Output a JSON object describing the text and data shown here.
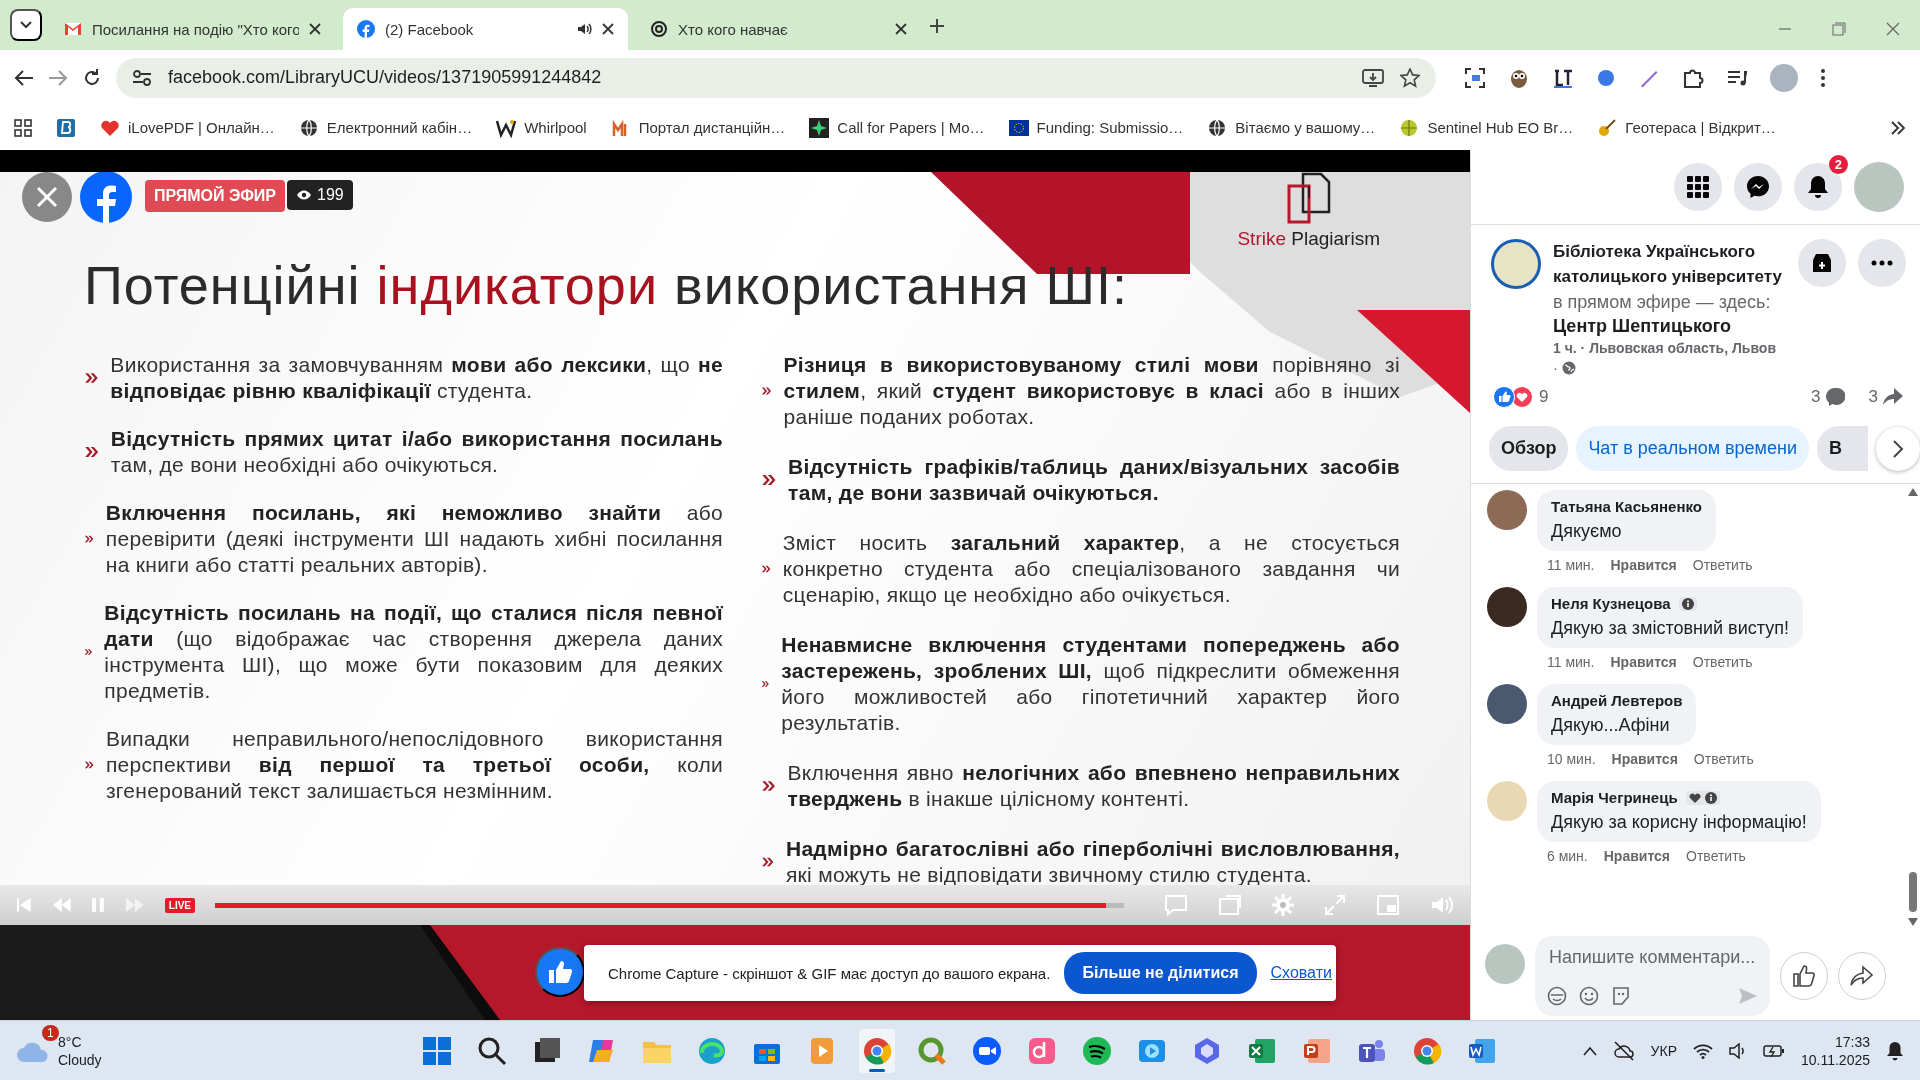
{
  "browser": {
    "tabs": [
      {
        "title": "Посилання на подію \"Хто кого",
        "audio": false,
        "selected": false
      },
      {
        "title": "(2) Facebook",
        "audio": true,
        "selected": true
      },
      {
        "title": "Хто кого навчає",
        "audio": false,
        "selected": false
      }
    ],
    "url": "facebook.com/LibraryUCU/videos/1371905991244842",
    "bookmarks": [
      {
        "label": "iLovePDF | Онлайн…"
      },
      {
        "label": "Електронний кабін…"
      },
      {
        "label": "Whirlpool"
      },
      {
        "label": "Портал дистанційн…"
      },
      {
        "label": "Call for Papers | Mo…"
      },
      {
        "label": "Funding: Submissio…"
      },
      {
        "label": "Вітаємо у вашому…"
      },
      {
        "label": "Sentinel Hub EO Br…"
      },
      {
        "label": "Геотераса | Відкрит…"
      }
    ]
  },
  "video": {
    "overlay": {
      "live_badge": "ПРЯМОЙ ЭФИР",
      "viewers": "199"
    },
    "slide": {
      "logo": [
        {
          "text": "Strike",
          "accent": true
        },
        {
          "text": " Plagiarism",
          "accent": false
        }
      ],
      "title": [
        {
          "text": "Потенційні ",
          "accent": false
        },
        {
          "text": "індикатори",
          "accent": true
        },
        {
          "text": " використання ШІ:",
          "accent": false
        }
      ],
      "columns": [
        [
          {
            "text": "Використання за замовчуванням **мови або лексики**, що **не відповідає рівню кваліфікації** студента.",
            "whole_bold": false
          },
          {
            "text": "**Відсутність прямих цитат і/або використання посилань** там, де вони необхідні або очікуються.",
            "whole_bold": false
          },
          {
            "text": "**Включення посилань, які неможливо знайти** або перевірити (деякі інструменти ШІ надають хибні посилання на книги або статті реальних авторів).",
            "whole_bold": false
          },
          {
            "text": "**Відсутність посилань на події, що сталися після певної дати** (що відображає час створення джерела даних інструмента ШІ), що може бути показовим для деяких предметів.",
            "whole_bold": false
          },
          {
            "text": "Випадки неправильного/непослідовного використання перспективи **від першої та третьої особи,** коли згенерований текст залишається незмінним.",
            "whole_bold": false
          }
        ],
        [
          {
            "text": "**Різниця в використовуваному стилі мови** порівняно зі **стилем**, який **студент використовує в класі** або в інших раніше поданих роботах.",
            "whole_bold": false
          },
          {
            "text": "Відсутність графіків/таблиць даних/візуальних засобів там, де вони зазвичай очікуються.",
            "whole_bold": true
          },
          {
            "text": "Зміст носить **загальний характер**, а не стосується конкретно студента або спеціалізованого завдання чи сценарію, якщо це необхідно або очікується.",
            "whole_bold": false
          },
          {
            "text": "**Ненавмисне включення студентами попереджень або застережень, зроблених ШІ,** щоб підкреслити обмеження його можливостей або гіпотетичний характер його результатів.",
            "whole_bold": false
          },
          {
            "text": "Включення явно **нелогічних або впевнено неправильних тверджень** в інакше цілісному контенті.",
            "whole_bold": false
          },
          {
            "text": "**Надмірно багатослівні або гіперболічні висловлювання,** які можуть не відповідати звичному стилю студента.",
            "whole_bold": false
          }
        ]
      ]
    },
    "controls": {
      "live": "LIVE",
      "progress": {
        "level": 0.98
      }
    }
  },
  "capture_bar": {
    "message": "Chrome Capture - скріншот & GIF має доступ до вашого екрана.",
    "button": "Більше не ділитися",
    "link": "Сховати"
  },
  "side": {
    "notifications": "2",
    "post": {
      "page": "Бібліотека Українського католицького університету",
      "status": "в прямом эфире — здесь:",
      "place": "Центр Шептицького",
      "meta": "1 ч. · Львовская область, Львов",
      "meta_dot": "·",
      "reactions": "9",
      "comments": "3",
      "shares": "3"
    },
    "tabs": [
      {
        "label": "Обзор",
        "selected": false
      },
      {
        "label": "Чат в реальном времени",
        "selected": true
      },
      {
        "label": "В",
        "selected": false
      }
    ],
    "comments": [
      {
        "author": "Татьяна Касьяненко",
        "text": "Дякуємо",
        "time": "11 мин.",
        "like": "Нравится",
        "reply": "Ответить"
      },
      {
        "author": "Неля Кузнецова",
        "text": "Дякую за змістовний виступ!",
        "time": "11 мин.",
        "like": "Нравится",
        "reply": "Ответить"
      },
      {
        "author": "Андрей Левтеров",
        "text": "Дякую...Афіни",
        "time": "10 мин.",
        "like": "Нравится",
        "reply": "Ответить"
      },
      {
        "author": "Марія Чегринець",
        "text": "Дякую за корисну інформацію!",
        "time": "6 мин.",
        "like": "Нравится",
        "reply": "Ответить"
      }
    ],
    "composer": {
      "placeholder": "Напишите комментари..."
    }
  },
  "taskbar": {
    "weather": {
      "temp": "8°C",
      "condition": "Cloudy",
      "badge": "1"
    },
    "apps": [
      {
        "kind": "windows",
        "selected": false
      },
      {
        "kind": "search",
        "selected": false
      },
      {
        "kind": "taskview",
        "selected": false
      },
      {
        "kind": "copilot",
        "selected": false
      },
      {
        "kind": "folder",
        "selected": false
      },
      {
        "kind": "edge",
        "selected": false
      },
      {
        "kind": "store",
        "selected": false
      },
      {
        "kind": "player",
        "selected": false
      },
      {
        "kind": "chrome",
        "selected": true
      },
      {
        "kind": "qgis",
        "selected": false
      },
      {
        "kind": "zoom",
        "selected": false
      },
      {
        "kind": "ds",
        "selected": false
      },
      {
        "kind": "spotify",
        "selected": false
      },
      {
        "kind": "video",
        "selected": false
      },
      {
        "kind": "hex",
        "selected": false
      },
      {
        "kind": "excel",
        "selected": false
      },
      {
        "kind": "powerpoint",
        "selected": false
      },
      {
        "kind": "teams",
        "selected": false
      },
      {
        "kind": "chrome",
        "selected": false
      },
      {
        "kind": "word",
        "selected": false
      }
    ],
    "tray": {
      "lang": "УКР",
      "time": "17:33",
      "date": "10.11.2025"
    }
  }
}
